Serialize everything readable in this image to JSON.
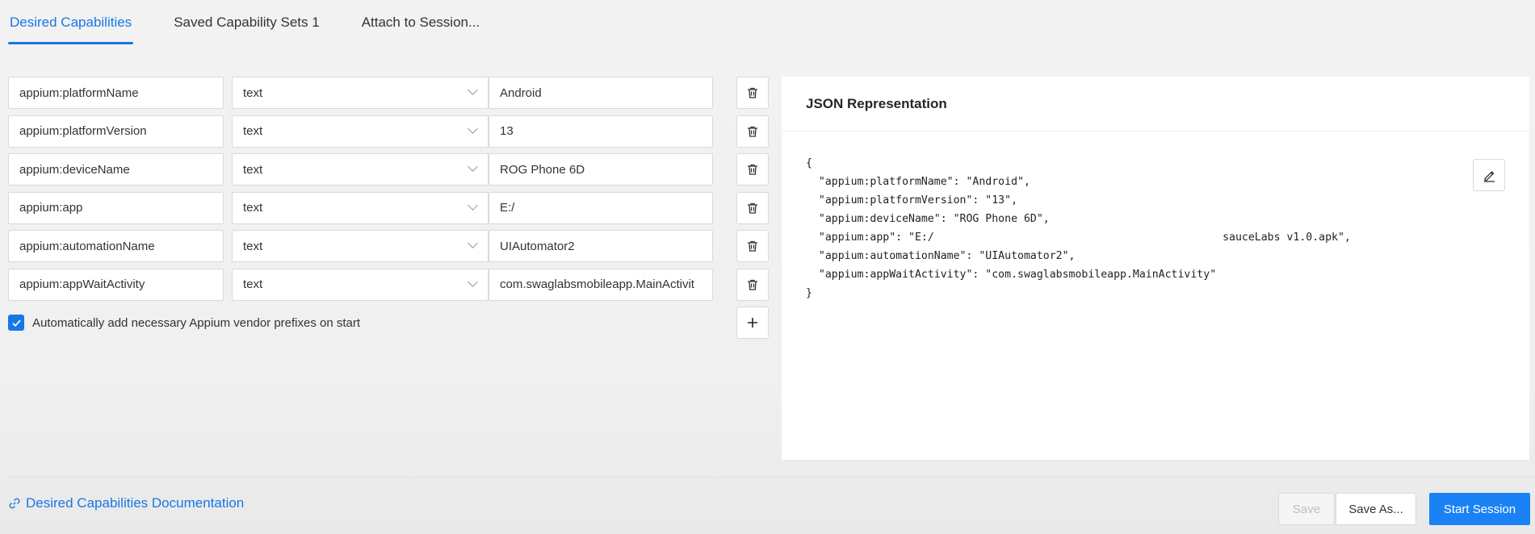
{
  "tabs": [
    {
      "label": "Desired Capabilities"
    },
    {
      "label": "Saved Capability Sets 1"
    },
    {
      "label": "Attach to Session..."
    }
  ],
  "capabilities": [
    {
      "name": "appium:platformName",
      "type": "text",
      "value": "Android"
    },
    {
      "name": "appium:platformVersion",
      "type": "text",
      "value": "13"
    },
    {
      "name": "appium:deviceName",
      "type": "text",
      "value": "ROG Phone 6D"
    },
    {
      "name": "appium:app",
      "type": "text",
      "value": "E:/"
    },
    {
      "name": "appium:automationName",
      "type": "text",
      "value": "UIAutomator2"
    },
    {
      "name": "appium:appWaitActivity",
      "type": "text",
      "value": "com.swaglabsmobileapp.MainActivit"
    }
  ],
  "vendor_prefix": {
    "checked": true,
    "label": "Automatically add necessary Appium vendor prefixes on start"
  },
  "json_panel": {
    "title": "JSON Representation",
    "lines": [
      "{",
      "  \"appium:platformName\": \"Android\",",
      "  \"appium:platformVersion\": \"13\",",
      "  \"appium:deviceName\": \"ROG Phone 6D\",",
      "  \"appium:app\": \"E:/                                             sauceLabs v1.0.apk\",",
      "  \"appium:automationName\": \"UIAutomator2\",",
      "  \"appium:appWaitActivity\": \"com.swaglabsmobileapp.MainActivity\"",
      "}"
    ]
  },
  "footer": {
    "doc_link": "Desired Capabilities Documentation",
    "save": "Save",
    "save_as": "Save As...",
    "start": "Start Session"
  },
  "colors": {
    "accent": "#1677e6",
    "primary_button": "#1a82f5"
  },
  "icons": {
    "delete": "trash-icon",
    "add": "plus-icon",
    "edit": "edit-pencil-icon",
    "link": "link-icon",
    "dropdown": "chevron-down-icon",
    "check": "check-icon"
  }
}
